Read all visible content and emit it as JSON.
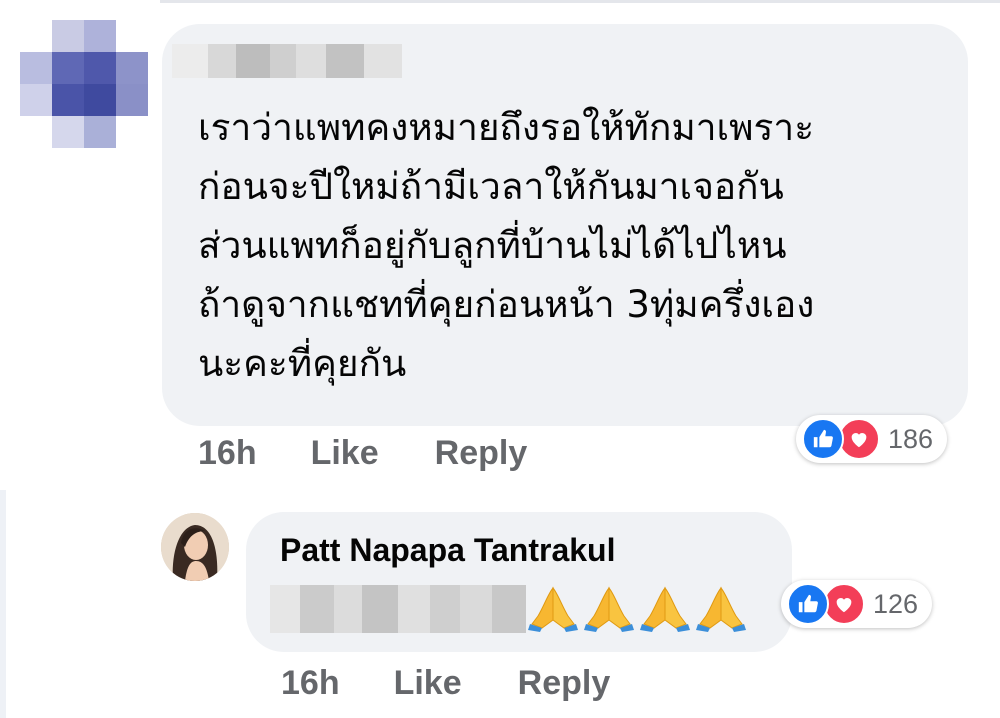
{
  "comment1": {
    "text": "เราว่าแพทคงหมายถึงรอให้ทักมาเพราะ\nก่อนจะปีใหม่ถ้ามีเวลาให้กันมาเจอกัน\nส่วนแพทก็อยู่กับลูกที่บ้านไม่ได้ไปไหน\nถ้าดูจากแชทที่คุยก่อนหน้า 3ทุ่มครึ่งเอง\nนะคะที่คุยกัน",
    "time": "16h",
    "like_label": "Like",
    "reply_label": "Reply",
    "reaction_count": "186"
  },
  "comment2": {
    "author": "Patt Napapa Tantrakul",
    "emoji": [
      "folded-hands-icon",
      "folded-hands-icon",
      "folded-hands-icon",
      "folded-hands-icon"
    ],
    "time": "16h",
    "like_label": "Like",
    "reply_label": "Reply",
    "reaction_count": "126"
  },
  "colors": {
    "bubble": "#f0f2f5",
    "secondary_text": "#65676b",
    "like_blue": "#1877f2",
    "love_red": "#f33e58"
  }
}
